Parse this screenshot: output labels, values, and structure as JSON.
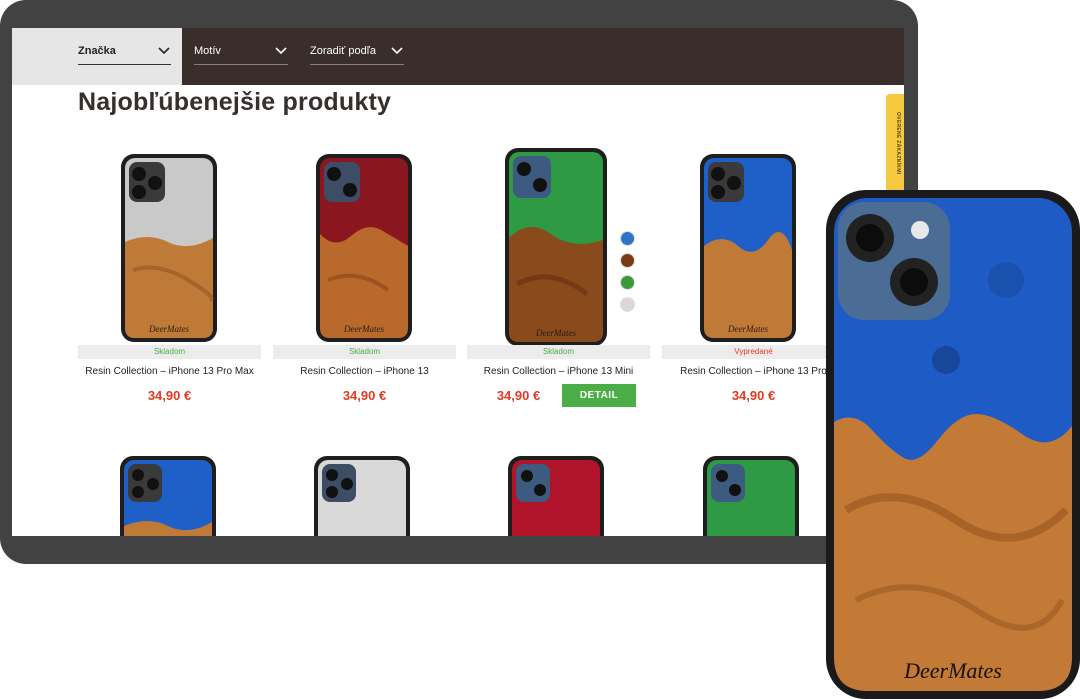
{
  "filters": [
    {
      "label": "Značka"
    },
    {
      "label": "Motív"
    },
    {
      "label": "Zoradiť podľa"
    }
  ],
  "page_title": "Najobľúbenejšie produkty",
  "side_tab": "OVERENÉ ZÁKAZNÍKMI",
  "products": [
    {
      "name": "Resin Collection – iPhone 13 Pro Max",
      "price": "34,90 €",
      "stock": "Skladom",
      "resin_color": "silver"
    },
    {
      "name": "Resin Collection – iPhone 13",
      "price": "34,90 €",
      "stock": "Skladom",
      "resin_color": "red"
    },
    {
      "name": "Resin Collection – iPhone 13 Mini",
      "price": "34,90 €",
      "stock": "Skladom",
      "resin_color": "green"
    },
    {
      "name": "Resin Collection – iPhone 13 Pro",
      "price": "34,90 €",
      "stock": "Vypredané",
      "resin_color": "blue"
    }
  ],
  "detail_button": "DETAIL",
  "second_row_colors": [
    "blue",
    "silver",
    "red",
    "green"
  ],
  "swatch_colors": [
    "#2f72c8",
    "#7a3b14",
    "#3a9a3a",
    "#d8d8d8"
  ],
  "brand_logo": "DeerMates",
  "colors": {
    "price_red": "#e23a22",
    "stock_green": "#4bad45",
    "header_brown": "#3a2e2b",
    "frame_gray": "#434242"
  }
}
